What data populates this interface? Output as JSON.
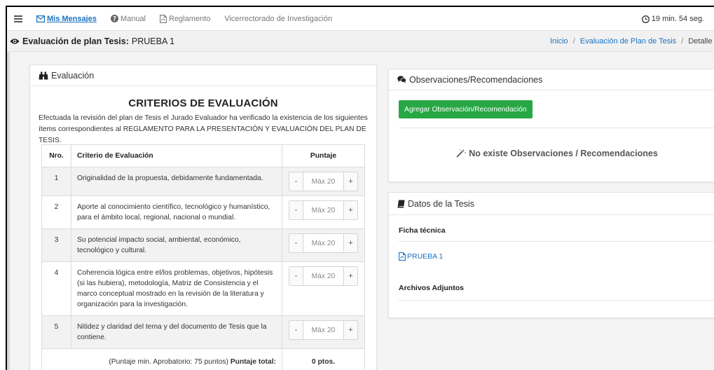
{
  "nav": {
    "mensajes": "Mis Mensajes",
    "manual": "Manual",
    "reglamento": "Reglamento",
    "vicerrectorado": "Vicerrectorado de Investigación",
    "timer": "19 min. 54 seg."
  },
  "page": {
    "title_bold": "Evaluación de plan Tesis:",
    "title_value": "PRUEBA 1"
  },
  "breadcrumb": {
    "inicio": "Inicio",
    "evaluacion": "Evaluación de Plan de Tesis",
    "current": "Detalle de l"
  },
  "evaluation": {
    "header": "Evaluación",
    "title": "CRITERIOS DE EVALUACIÓN",
    "description": "Efectuada la revisión del plan de Tesis el Jurado Evaluador ha verificado la existencia de los siguientes ítems correspondientes al REGLAMENTO PARA LA PRESENTACIÓN Y EVALUACIÓN DEL PLAN DE TESIS.",
    "columns": {
      "nro": "Nro.",
      "criterio": "Criterio de Evaluación",
      "puntaje": "Puntaje"
    },
    "rows": [
      {
        "nro": "1",
        "criterio": "Originalidad de la propuesta, debidamente fundamentada.",
        "placeholder": "Máx 20"
      },
      {
        "nro": "2",
        "criterio": "Aporte al conocimiento científico, tecnológico y humanístico, para el ámbito local, regional, nacional o mundial.",
        "placeholder": "Máx 20"
      },
      {
        "nro": "3",
        "criterio": "Su potencial impacto social, ambiental, económico, tecnológico y cultural.",
        "placeholder": "Máx 20"
      },
      {
        "nro": "4",
        "criterio": "Coherencia lógica entre el/los problemas, objetivos, hipótesis (si las hubiera), metodología, Matriz de Consistencia y el marco conceptual mostrado en la revisión de la literatura y organización para la investigación.",
        "placeholder": "Máx 20"
      },
      {
        "nro": "5",
        "criterio": "Nitidez y claridad del tema y del documento de Tesis que la contiene.",
        "placeholder": "Máx 20"
      }
    ],
    "stepper_minus": "-",
    "stepper_plus": "+",
    "total_note": "(Puntaje min. Aprobatorio: 75 puntos)",
    "total_label": "Puntaje total:",
    "total_value": "0 ptos."
  },
  "observaciones": {
    "header": "Observaciones/Recomendaciones",
    "add_button": "Agregar Observación/Recomendación",
    "empty": "No existe Observaciones / Recomendaciones"
  },
  "datos": {
    "header": "Datos de la Tesis",
    "ficha": "Ficha técnica",
    "file_link": "PRUEBA 1",
    "archivos": "Archivos Adjuntos"
  },
  "colors": {
    "link": "#1a73c4",
    "button_green": "#28a745"
  }
}
